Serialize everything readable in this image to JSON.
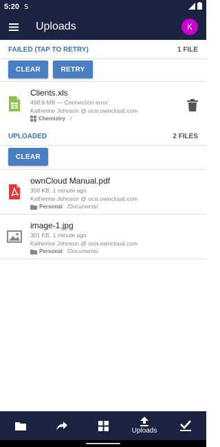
{
  "status_bar": {
    "time": "5:20"
  },
  "app_bar": {
    "title": "Uploads",
    "avatar_letter": "K",
    "avatar_color": "#cc00cc"
  },
  "failed": {
    "header": "FAILED (TAP TO RETRY)",
    "count": "1 FILE",
    "buttons": {
      "clear": "CLEAR",
      "retry": "RETRY"
    },
    "items": [
      {
        "name": "Clients.xls",
        "meta": "498.6 MB — Connection error",
        "account": "Katherine Johnson @ ocis.owncloud.com",
        "space": "Chemistry",
        "path": "/",
        "icon": "spreadsheet-icon"
      }
    ]
  },
  "uploaded": {
    "header": "UPLOADED",
    "count": "2 FILES",
    "buttons": {
      "clear": "CLEAR"
    },
    "items": [
      {
        "name": "ownCloud Manual.pdf",
        "meta": "308 KB, 1 minute ago",
        "account": "Katherine Johnson @ ocis.owncloud.com",
        "space": "Personal",
        "path": "/Documents/",
        "icon": "pdf-icon"
      },
      {
        "name": "image-1.jpg",
        "meta": "301 KB, 1 minute ago",
        "account": "Katherine Johnson @ ocis.owncloud.com",
        "space": "Personal",
        "path": "/Documents/",
        "icon": "image-icon"
      }
    ]
  },
  "bottom_nav": [
    {
      "icon": "folder-icon",
      "label": ""
    },
    {
      "icon": "share-icon",
      "label": ""
    },
    {
      "icon": "spaces-icon",
      "label": ""
    },
    {
      "icon": "upload-icon",
      "label": "Uploads"
    },
    {
      "icon": "checkmark-icon",
      "label": ""
    }
  ],
  "colors": {
    "primary": "#1c2340",
    "accent": "#4a7fc4",
    "section_label": "#3b73b9"
  }
}
